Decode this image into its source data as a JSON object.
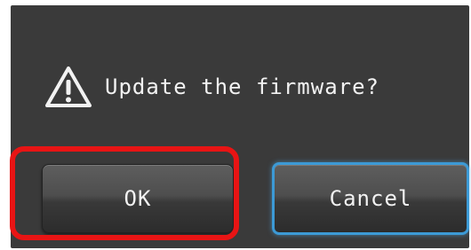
{
  "dialog": {
    "message": "Update the firmware?",
    "icon": "warning-icon"
  },
  "buttons": {
    "ok_label": "OK",
    "cancel_label": "Cancel"
  },
  "colors": {
    "screen_background": "#3a3a3a",
    "highlight": "#e81414",
    "focus_border": "#3c9ad6",
    "text": "#f2f2f2"
  }
}
